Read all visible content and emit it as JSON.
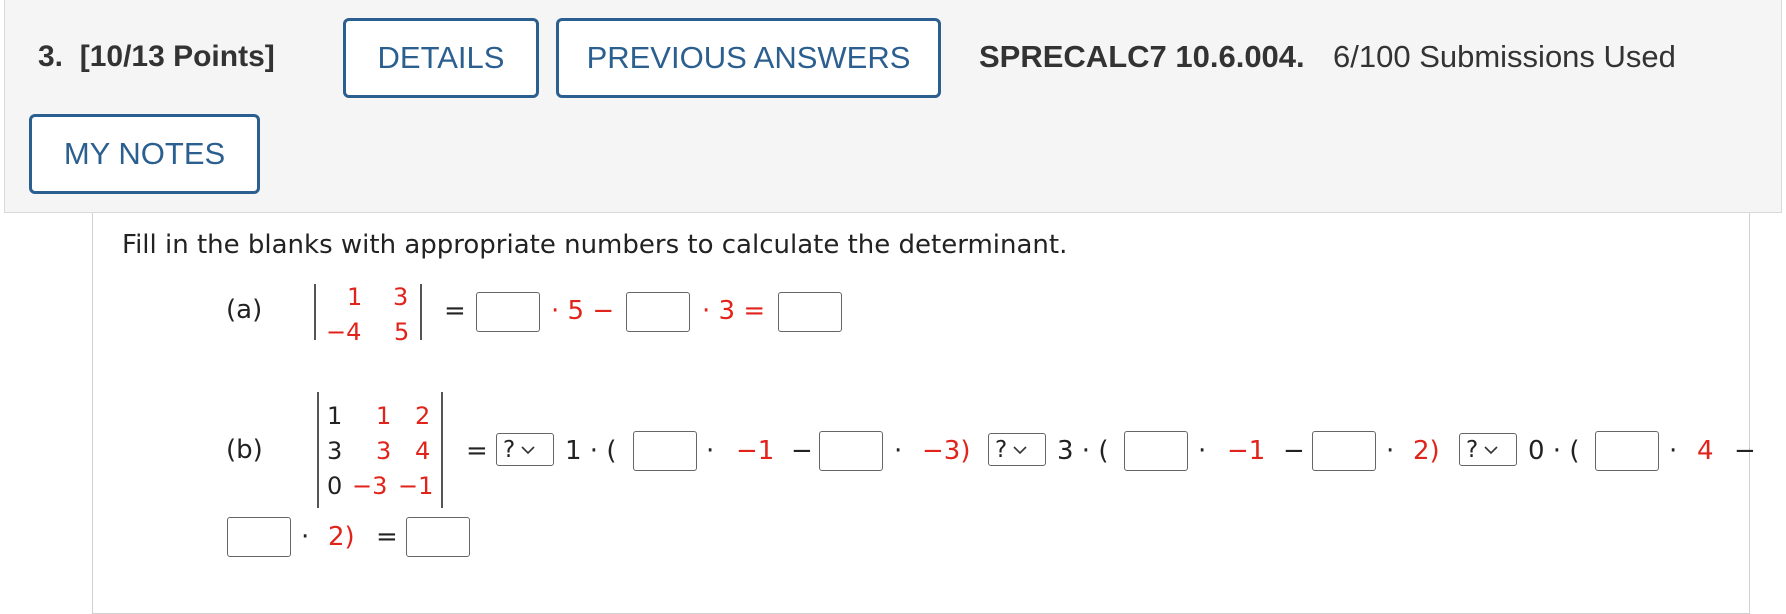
{
  "header": {
    "question_number": "3.",
    "points": "[10/13 Points]",
    "details_label": "DETAILS",
    "previous_answers_label": "PREVIOUS ANSWERS",
    "problem_code": "SPRECALC7 10.6.004.",
    "submissions": "6/100 Submissions Used",
    "my_notes_label": "MY NOTES"
  },
  "question": {
    "prompt": "Fill in the blanks with appropriate numbers to calculate the determinant.",
    "part_a": {
      "label": "(a)",
      "matrix": [
        [
          "1",
          "3"
        ],
        [
          "−4",
          "5"
        ]
      ],
      "eq1": "=",
      "dot_5_minus": "· 5 −",
      "dot_3_eq": "· 3 ="
    },
    "part_b": {
      "label": "(b)",
      "matrix": [
        [
          "1",
          "1",
          "2"
        ],
        [
          "3",
          "3",
          "4"
        ],
        [
          "0",
          "−3",
          "−1"
        ]
      ],
      "eq": "=",
      "select_placeholder": "?",
      "term1_prefix": "1 · (",
      "term1_mid": "·",
      "term1_v1": "−1",
      "term1_minus": "−",
      "term1_mid2": "·",
      "term1_v2": "−3)",
      "term2_prefix": "3 · (",
      "term2_mid": "·",
      "term2_v1": "−1",
      "term2_minus": "−",
      "term2_mid2": "·",
      "term2_v2": "2)",
      "term3_prefix": "0 · (",
      "term3_mid": "·",
      "term3_v1": "4",
      "term3_minus": "−",
      "line2_mid": "·",
      "line2_v": "2)",
      "final_eq": "="
    }
  },
  "colors": {
    "accent": "#2b5f8f",
    "red": "#e0231b",
    "header_bg": "#f5f5f5"
  }
}
